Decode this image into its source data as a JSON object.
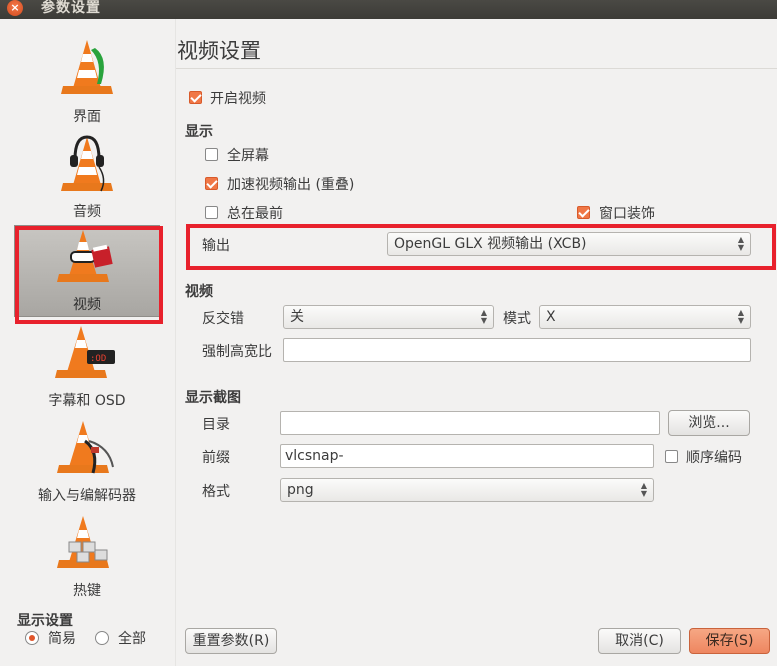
{
  "window": {
    "title": "参数设置"
  },
  "sidebar": {
    "items": [
      {
        "label": "界面",
        "icon": "vlc-cone-interface-icon"
      },
      {
        "label": "音频",
        "icon": "vlc-cone-audio-icon"
      },
      {
        "label": "视频",
        "icon": "vlc-cone-video-icon",
        "selected": true
      },
      {
        "label": "字幕和 OSD",
        "icon": "vlc-cone-subtitles-icon"
      },
      {
        "label": "输入与编解码器",
        "icon": "vlc-cone-codecs-icon"
      },
      {
        "label": "热键",
        "icon": "vlc-cone-hotkeys-icon"
      }
    ],
    "show_settings_label": "显示设置",
    "mode_simple": "简易",
    "mode_all": "全部",
    "selected_mode": "简易"
  },
  "main": {
    "title": "视频设置",
    "enable_video": {
      "label": "开启视频",
      "checked": true
    },
    "display": {
      "heading": "显示",
      "fullscreen": {
        "label": "全屏幕",
        "checked": false
      },
      "accelerated": {
        "label": "加速视频输出 (重叠)",
        "checked": true
      },
      "always_on_top": {
        "label": "总在最前",
        "checked": false
      },
      "window_decorations": {
        "label": "窗口装饰",
        "checked": true
      },
      "output_label": "输出",
      "output_value": "OpenGL GLX 视频输出 (XCB)"
    },
    "video": {
      "heading": "视频",
      "deinterlace_label": "反交错",
      "deinterlace_value": "关",
      "mode_label": "模式",
      "mode_value": "X",
      "aspect_label": "强制高宽比",
      "aspect_value": ""
    },
    "snapshot": {
      "heading": "显示截图",
      "directory_label": "目录",
      "directory_value": "",
      "browse_label": "浏览...",
      "prefix_label": "前缀",
      "prefix_value": "vlcsnap-",
      "sequential_label": "顺序编码",
      "sequential_checked": false,
      "format_label": "格式",
      "format_value": "png"
    }
  },
  "footer": {
    "reset_label": "重置参数(R)",
    "cancel_label": "取消(C)",
    "save_label": "保存(S)"
  },
  "colors": {
    "accent": "#f07746",
    "highlight_box": "#e8212c",
    "titlebar": "#3c3b37"
  }
}
